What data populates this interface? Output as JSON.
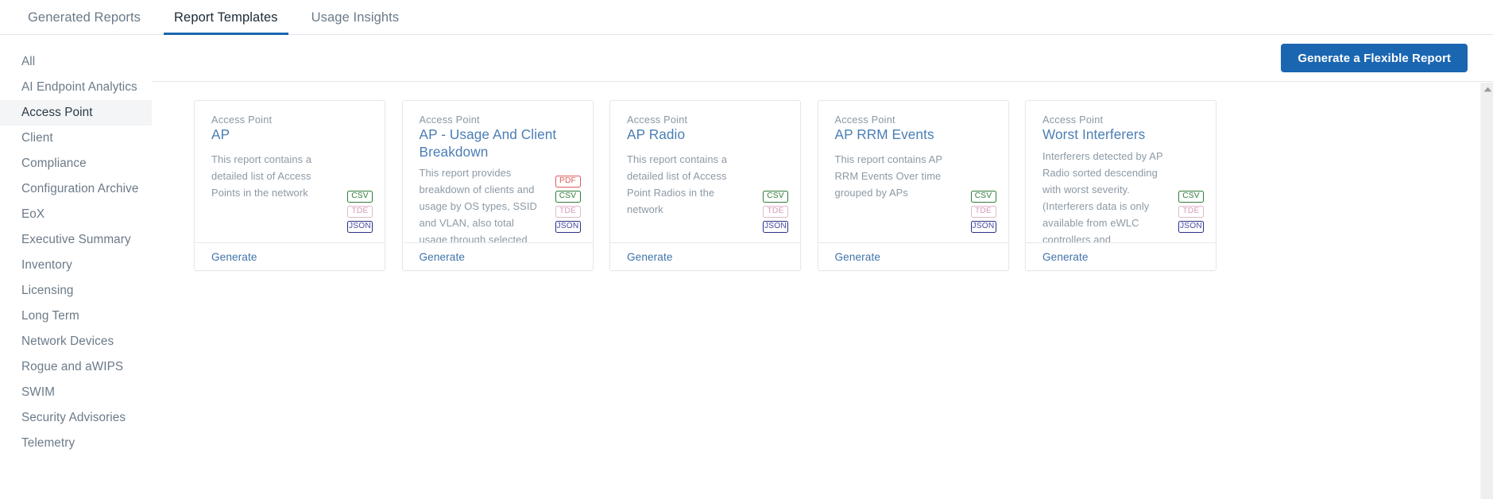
{
  "tabs": [
    {
      "label": "Generated Reports",
      "active": false
    },
    {
      "label": "Report Templates",
      "active": true
    },
    {
      "label": "Usage Insights",
      "active": false
    }
  ],
  "sidebar": {
    "items": [
      {
        "label": "All",
        "active": false
      },
      {
        "label": "AI Endpoint Analytics",
        "active": false
      },
      {
        "label": "Access Point",
        "active": true
      },
      {
        "label": "Client",
        "active": false
      },
      {
        "label": "Compliance",
        "active": false
      },
      {
        "label": "Configuration Archive",
        "active": false
      },
      {
        "label": "EoX",
        "active": false
      },
      {
        "label": "Executive Summary",
        "active": false
      },
      {
        "label": "Inventory",
        "active": false
      },
      {
        "label": "Licensing",
        "active": false
      },
      {
        "label": "Long Term",
        "active": false
      },
      {
        "label": "Network Devices",
        "active": false
      },
      {
        "label": "Rogue and aWIPS",
        "active": false
      },
      {
        "label": "SWIM",
        "active": false
      },
      {
        "label": "Security Advisories",
        "active": false
      },
      {
        "label": "Telemetry",
        "active": false
      }
    ]
  },
  "toolbar": {
    "flexible_report_label": "Generate a Flexible Report"
  },
  "colors": {
    "accent": "#1b66b1",
    "tab_active_text": "#1b2a35",
    "link": "#3f72ab",
    "title_link": "#4a7eb5",
    "muted_text": "#8c99a5",
    "badge_pdf": "#e05a5a",
    "badge_csv": "#2f7d3a",
    "badge_tde": "#d59ab8",
    "badge_json": "#474ca0",
    "sidebar_active_bg": "#f4f5f6"
  },
  "cards": [
    {
      "category": "Access Point",
      "title": "AP",
      "description": "This report contains a detailed list of Access Points in the network",
      "formats": [
        "CSV",
        "TDE",
        "JSON"
      ],
      "generate_label": "Generate"
    },
    {
      "category": "Access Point",
      "title": "AP - Usage And Client Breakdown",
      "description": "This report provides breakdown of clients and usage by OS types, SSID and VLAN, also total usage through selected APs",
      "formats": [
        "PDF",
        "CSV",
        "TDE",
        "JSON"
      ],
      "generate_label": "Generate"
    },
    {
      "category": "Access Point",
      "title": "AP Radio",
      "description": "This report contains a detailed list of Access Point Radios in the network",
      "formats": [
        "CSV",
        "TDE",
        "JSON"
      ],
      "generate_label": "Generate"
    },
    {
      "category": "Access Point",
      "title": "AP RRM Events",
      "description": "This report contains AP RRM Events Over time grouped by APs",
      "formats": [
        "CSV",
        "TDE",
        "JSON"
      ],
      "generate_label": "Generate"
    },
    {
      "category": "Access Point",
      "title": "Worst Interferers",
      "description": "Interferers detected by AP Radio sorted descending with worst severity. (Interferers data is only available from eWLC controllers and unavailable from AireOS controllers, and",
      "formats": [
        "CSV",
        "TDE",
        "JSON"
      ],
      "generate_label": "Generate"
    }
  ],
  "scrollbar": {
    "up_arrow_icon": "chevron-up-icon"
  }
}
